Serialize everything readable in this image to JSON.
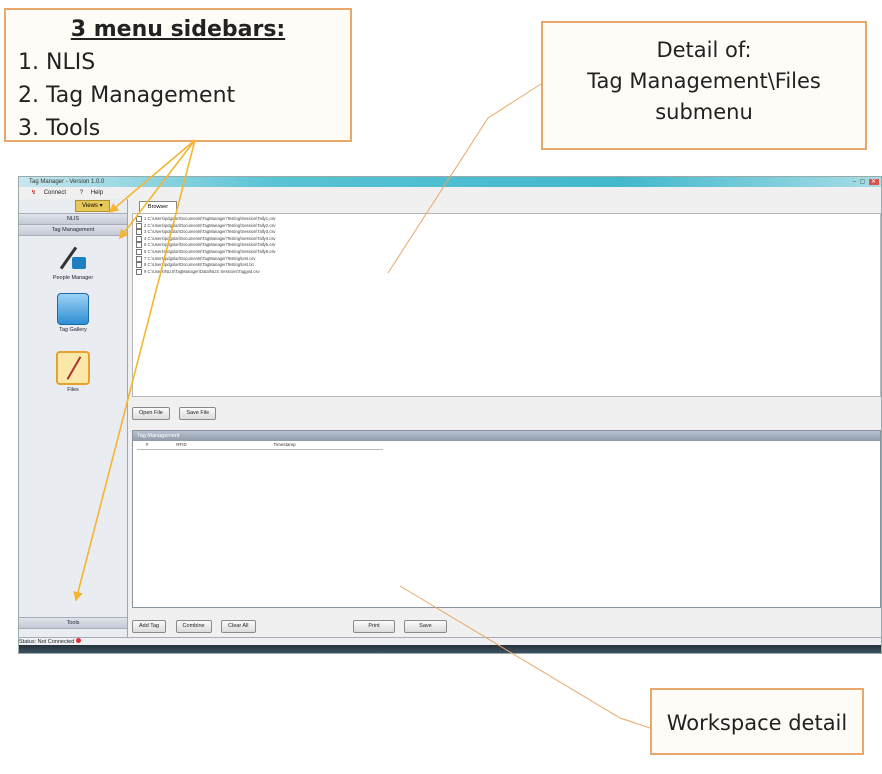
{
  "callouts": {
    "sidebars": {
      "title": "3 menu sidebars:",
      "items": [
        "NLIS",
        "Tag Management",
        "Tools"
      ]
    },
    "files_detail": {
      "line1": "Detail of:",
      "line2": "Tag Management\\Files",
      "line3": "submenu"
    },
    "workspace": {
      "text": "Workspace detail"
    }
  },
  "app": {
    "title": "Tag Manager - Version 1.0.0",
    "menu": {
      "connect": "Connect",
      "help": "Help"
    },
    "sidebar": {
      "view_dropdown": "Views ▾",
      "nlis": "NLIS",
      "tag_management": "Tag Management",
      "tools": "Tools",
      "items": [
        {
          "label": "People Manager"
        },
        {
          "label": "Tag Gallery"
        },
        {
          "label": "Files"
        }
      ]
    },
    "tabs": {
      "browser": "Browser"
    },
    "files": [
      "1  C:\\Users\\pdgolar\\Documents\\TagManager\\Testing\\Session\\Tally1.csv",
      "2  C:\\Users\\pdgolar\\Documents\\TagManager\\Testing\\Session\\Tally2.csv",
      "3  C:\\Users\\pdgolar\\Documents\\TagManager\\Testing\\Session\\Tally3.csv",
      "4  C:\\Users\\pdgolar\\Documents\\TagManager\\Testing\\Session\\Tally4.csv",
      "5  C:\\Users\\pdgolar\\Documents\\TagManager\\Testing\\Session\\Tally5.csv",
      "6  C:\\Users\\pdgolar\\Documents\\TagManager\\Testing\\Session\\Tally6.csv",
      "7  C:\\Users\\pdgolar\\Documents\\TagManager\\Testing\\test.csv",
      "8  C:\\Users\\pdgolar\\Documents\\TagManager\\Testing\\test.txt",
      "9  C:\\Users\\NLIS\\TagManager\\Data\\NLIS Sessions\\Tagged.csv"
    ],
    "file_buttons": {
      "open": "Open File",
      "save": "Save File"
    },
    "tag_panel": {
      "header": "Tag Management",
      "columns": [
        "#",
        "RFID",
        "Timestamp"
      ]
    },
    "tag_buttons": {
      "add": "Add Tag",
      "combine": "Combine",
      "clear": "Clear All",
      "print": "Print",
      "save": "Save"
    },
    "status": "Status: Not Connected"
  },
  "colors": {
    "callout_border": "#e8a869",
    "arrow_yellow": "#f5b531",
    "title_bar": "#43b8cc"
  }
}
